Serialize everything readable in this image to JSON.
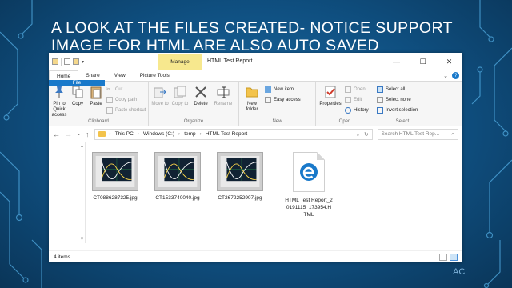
{
  "slide": {
    "title": "A LOOK AT THE FILES CREATED- NOTICE SUPPORT IMAGE FOR HTML ARE ALSO AUTO SAVED",
    "footer": "AC"
  },
  "window": {
    "manage_label": "Manage",
    "title": "HTML Test Report",
    "controls": {
      "minimize": "—",
      "maximize": "☐",
      "close": "✕"
    }
  },
  "tabs": [
    "File",
    "Home",
    "Share",
    "View",
    "Picture Tools"
  ],
  "ribbon": {
    "clipboard": {
      "label": "Clipboard",
      "pin": "Pin to Quick access",
      "copy": "Copy",
      "paste": "Paste",
      "cut": "Cut",
      "copy_path": "Copy path",
      "paste_shortcut": "Paste shortcut"
    },
    "organize": {
      "label": "Organize",
      "move_to": "Move to",
      "copy_to": "Copy to",
      "delete": "Delete",
      "rename": "Rename"
    },
    "new": {
      "label": "New",
      "new_folder": "New folder",
      "new_item": "New item",
      "easy_access": "Easy access"
    },
    "open": {
      "label": "Open",
      "properties": "Properties",
      "open": "Open",
      "edit": "Edit",
      "history": "History"
    },
    "select": {
      "label": "Select",
      "select_all": "Select all",
      "select_none": "Select none",
      "invert_selection": "Invert selection"
    }
  },
  "address": {
    "path": [
      "This PC",
      "Windows (C:)",
      "temp",
      "HTML Test Report"
    ],
    "search_placeholder": "Search HTML Test Rep..."
  },
  "files": [
    {
      "name": "CT0886287325.jpg",
      "kind": "image"
    },
    {
      "name": "CT1533740040.jpg",
      "kind": "image"
    },
    {
      "name": "CT2672252907.jpg",
      "kind": "image"
    },
    {
      "name": "HTML Test Report_20191115_173954.HTML",
      "kind": "html"
    }
  ],
  "status": {
    "count": "4 items"
  },
  "colors": {
    "accent": "#1979ca",
    "manage": "#f7e88e",
    "folder": "#f3c34b"
  }
}
